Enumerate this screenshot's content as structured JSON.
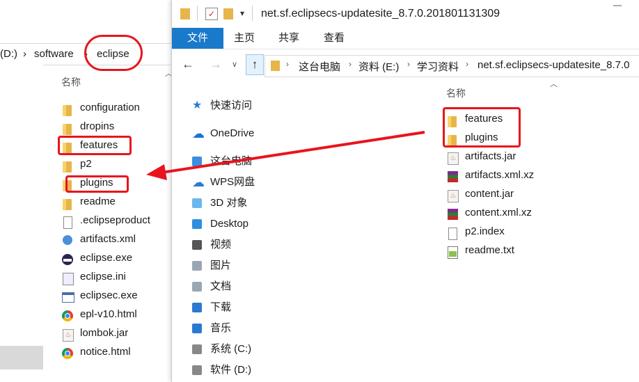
{
  "back_window": {
    "breadcrumb": [
      "(D:)",
      "software",
      "eclipse"
    ],
    "column_header": "名称",
    "files": [
      {
        "name": "configuration",
        "icon": "folder-icon"
      },
      {
        "name": "dropins",
        "icon": "folder-icon"
      },
      {
        "name": "features",
        "icon": "folder-icon"
      },
      {
        "name": "p2",
        "icon": "folder-icon"
      },
      {
        "name": "plugins",
        "icon": "folder-icon"
      },
      {
        "name": "readme",
        "icon": "folder-icon"
      },
      {
        "name": ".eclipseproduct",
        "icon": "file-icon"
      },
      {
        "name": "artifacts.xml",
        "icon": "xml-icon"
      },
      {
        "name": "eclipse.exe",
        "icon": "eclipse-icon"
      },
      {
        "name": "eclipse.ini",
        "icon": "ini-icon"
      },
      {
        "name": "eclipsec.exe",
        "icon": "exe-icon"
      },
      {
        "name": "epl-v10.html",
        "icon": "chrome-icon"
      },
      {
        "name": "lombok.jar",
        "icon": "java-icon"
      },
      {
        "name": "notice.html",
        "icon": "chrome-icon"
      }
    ]
  },
  "front_window": {
    "title": "net.sf.eclipsecs-updatesite_8.7.0.201801131309",
    "ribbon_tabs": [
      "文件",
      "主页",
      "共享",
      "查看"
    ],
    "address": [
      "这台电脑",
      "资料 (E:)",
      "学习资料",
      "net.sf.eclipsecs-updatesite_8.7.0"
    ],
    "nav_items": [
      {
        "label": "快速访问",
        "icon": "star-icon"
      },
      {
        "label": "OneDrive",
        "icon": "cloud-icon"
      },
      {
        "label": "这台电脑",
        "icon": "pc-icon"
      },
      {
        "label": "WPS网盘",
        "icon": "cloud-outline-icon"
      },
      {
        "label": "3D 对象",
        "icon": "3d-objects-icon"
      },
      {
        "label": "Desktop",
        "icon": "desktop-icon"
      },
      {
        "label": "视频",
        "icon": "video-icon"
      },
      {
        "label": "图片",
        "icon": "pictures-icon"
      },
      {
        "label": "文档",
        "icon": "documents-icon"
      },
      {
        "label": "下载",
        "icon": "downloads-icon"
      },
      {
        "label": "音乐",
        "icon": "music-icon"
      },
      {
        "label": "系统 (C:)",
        "icon": "system-drive-icon"
      },
      {
        "label": "软件 (D:)",
        "icon": "drive-icon"
      }
    ],
    "column_header": "名称",
    "files": [
      {
        "name": "features",
        "icon": "folder-icon"
      },
      {
        "name": "plugins",
        "icon": "folder-icon"
      },
      {
        "name": "artifacts.jar",
        "icon": "java-icon"
      },
      {
        "name": "artifacts.xml.xz",
        "icon": "archive-icon"
      },
      {
        "name": "content.jar",
        "icon": "java-icon"
      },
      {
        "name": "content.xml.xz",
        "icon": "archive-icon"
      },
      {
        "name": "p2.index",
        "icon": "file-icon"
      },
      {
        "name": "readme.txt",
        "icon": "text-file-icon"
      }
    ]
  },
  "annotation_color": "#e8141e"
}
